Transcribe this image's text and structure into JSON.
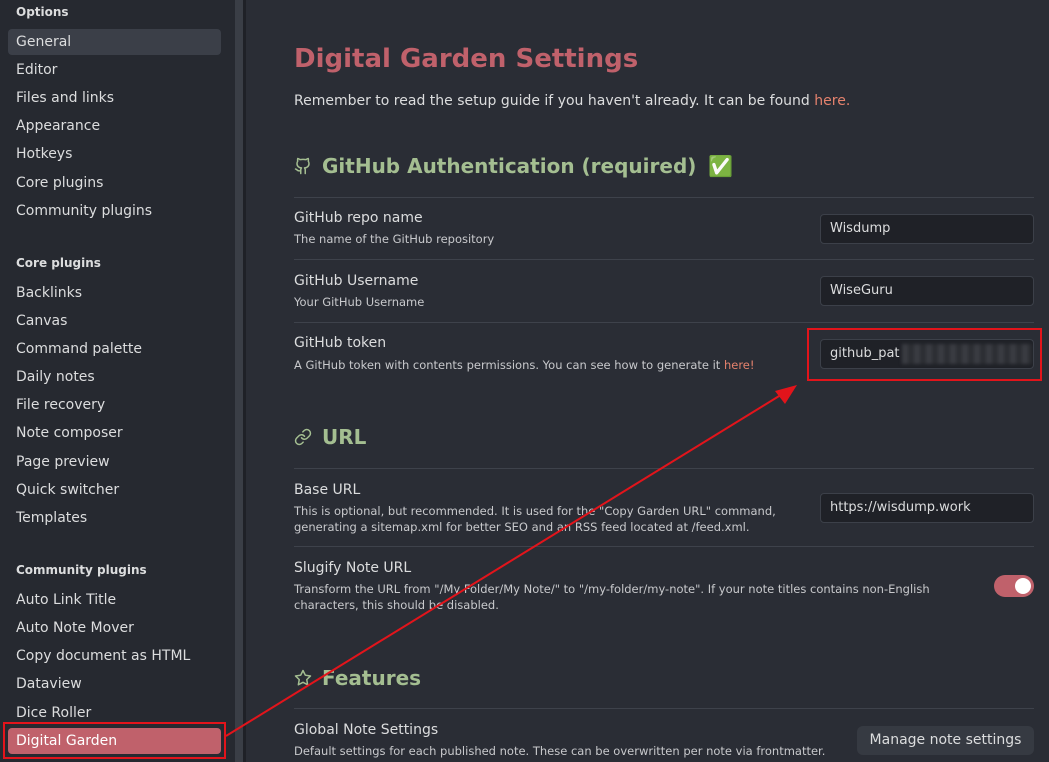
{
  "sidebar": {
    "options_title": "Options",
    "options": [
      "General",
      "Editor",
      "Files and links",
      "Appearance",
      "Hotkeys",
      "Core plugins",
      "Community plugins"
    ],
    "core_title": "Core plugins",
    "core": [
      "Backlinks",
      "Canvas",
      "Command palette",
      "Daily notes",
      "File recovery",
      "Note composer",
      "Page preview",
      "Quick switcher",
      "Templates"
    ],
    "community_title": "Community plugins",
    "community": [
      "Auto Link Title",
      "Auto Note Mover",
      "Copy document as HTML",
      "Dataview",
      "Dice Roller",
      "Digital Garden"
    ]
  },
  "main": {
    "title": "Digital Garden Settings",
    "intro": "Remember to read the setup guide if you haven't already. It can be found ",
    "intro_link": "here.",
    "github_section": "GitHub Authentication (required)",
    "github_check": "✅",
    "repo_name": "GitHub repo name",
    "repo_desc": "The name of the GitHub repository",
    "repo_value": "Wisdump",
    "username_name": "GitHub Username",
    "username_desc": "Your GitHub Username",
    "username_value": "WiseGuru",
    "token_name": "GitHub token",
    "token_desc": "A GitHub token with contents permissions. You can see how to generate it ",
    "token_link": "here!",
    "token_value": "github_pat",
    "url_section": "URL",
    "base_url_name": "Base URL",
    "base_url_desc1": "This is optional, but recommended. It is used for the \"Copy Garden URL\" command,",
    "base_url_desc2": "generating a sitemap.xml for better SEO and an RSS feed located at /feed.xml.",
    "base_url_value": "https://wisdump.work",
    "slug_name": "Slugify Note URL",
    "slug_desc1": "Transform the URL from \"/My Folder/My Note/\" to \"/my-folder/my-note\". If your note titles contains non-English",
    "slug_desc2": "characters, this should be disabled.",
    "slug_enabled": true,
    "features_section": "Features",
    "global_name": "Global Note Settings",
    "global_desc": "Default settings for each published note. These can be overwritten per note via frontmatter.",
    "manage_button": "Manage note settings"
  },
  "colors": {
    "accent": "#c0616b",
    "section": "#a4be91",
    "annotation": "#e2141b"
  }
}
